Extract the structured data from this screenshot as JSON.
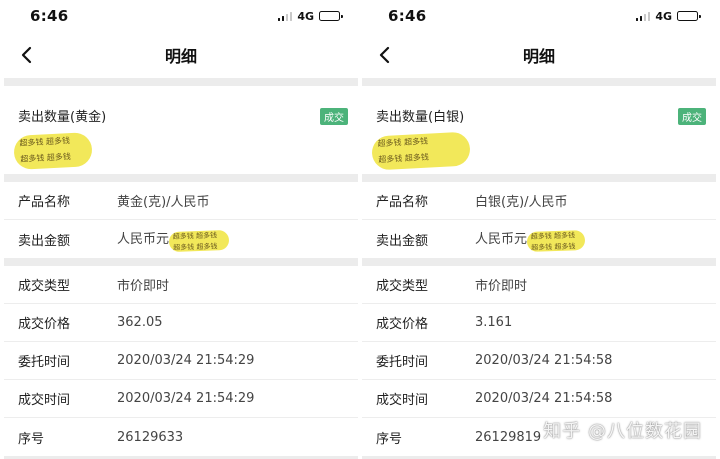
{
  "left": {
    "status": {
      "time": "6:46",
      "network": "4G"
    },
    "nav": {
      "title": "明细"
    },
    "quantity_label": "卖出数量(黄金)",
    "badge": "成交",
    "redaction_text": "超多钱 超多钱",
    "rows_a": [
      {
        "key": "产品名称",
        "value": "黄金(克)/人民币"
      },
      {
        "key": "卖出金额",
        "value": "人民币元"
      }
    ],
    "rows_b": [
      {
        "key": "成交类型",
        "value": "市价即时"
      },
      {
        "key": "成交价格",
        "value": "362.05"
      },
      {
        "key": "委托时间",
        "value": "2020/03/24 21:54:29"
      },
      {
        "key": "成交时间",
        "value": "2020/03/24 21:54:29"
      },
      {
        "key": "序号",
        "value": "26129633"
      }
    ]
  },
  "right": {
    "status": {
      "time": "6:46",
      "network": "4G"
    },
    "nav": {
      "title": "明细"
    },
    "quantity_label": "卖出数量(白银)",
    "badge": "成交",
    "redaction_text": "超多钱 超多钱",
    "rows_a": [
      {
        "key": "产品名称",
        "value": "白银(克)/人民币"
      },
      {
        "key": "卖出金额",
        "value": "人民币元"
      }
    ],
    "rows_b": [
      {
        "key": "成交类型",
        "value": "市价即时"
      },
      {
        "key": "成交价格",
        "value": "3.161"
      },
      {
        "key": "委托时间",
        "value": "2020/03/24 21:54:58"
      },
      {
        "key": "成交时间",
        "value": "2020/03/24 21:54:58"
      },
      {
        "key": "序号",
        "value": "26129819"
      }
    ]
  },
  "watermark": "知乎 @八位数花园",
  "colors": {
    "badge_green": "#4cb37a",
    "redaction_yellow": "#f2e85a",
    "section_gray": "#ececec"
  }
}
